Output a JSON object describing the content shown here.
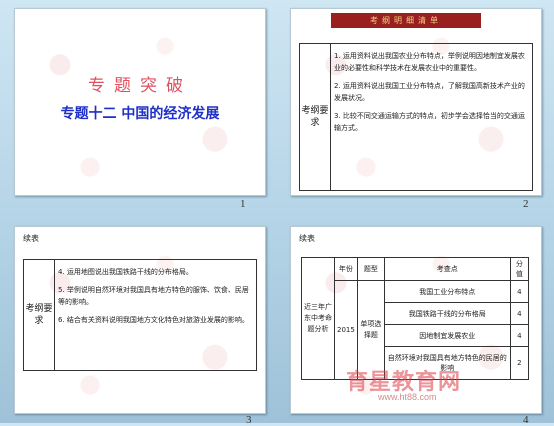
{
  "slide1": {
    "title": "专题突破",
    "subtitle": "专题十二   中国的经济发展",
    "number": "1"
  },
  "slide2": {
    "header": "考纲明细清单",
    "label": "考纲要求",
    "items": [
      "1. 运用资料说出我国农业分布特点，举例说明因地制宜发展农业的必要性和科学技术在发展农业中的重要性。",
      "2. 运用资料说出我国工业分布特点，了解我国高新技术产业的发展状况。",
      "3. 比较不同交通运输方式的特点，初步学会选择恰当的交通运输方式。"
    ],
    "number": "2"
  },
  "slide3": {
    "section": "续表",
    "label": "考纲要求",
    "items": [
      "4. 运用地图说出我国铁路干线的分布格局。",
      "5. 举例说明自然环境对我国具有地方特色的服饰、饮食、民居等的影响。",
      "6. 结合有关资料说明我国地方文化特色对旅游业发展的影响。"
    ],
    "number": "3"
  },
  "slide4": {
    "section": "续表",
    "headers": [
      "年份",
      "题型",
      "考查点",
      "分值"
    ],
    "side_label": "近三年广东中考命题分析",
    "year": "2015",
    "type": "单项选择题",
    "rows": [
      {
        "point": "我国工业分布特点",
        "score": "4"
      },
      {
        "point": "我国铁路干线的分布格局",
        "score": "4"
      },
      {
        "point": "因地制宜发展农业",
        "score": "4"
      },
      {
        "point": "自然环境对我国具有地方特色的民居的影响",
        "score": "2"
      }
    ],
    "number": "4"
  },
  "watermark": {
    "text": "育星教育网",
    "url": "www.ht88.com"
  }
}
